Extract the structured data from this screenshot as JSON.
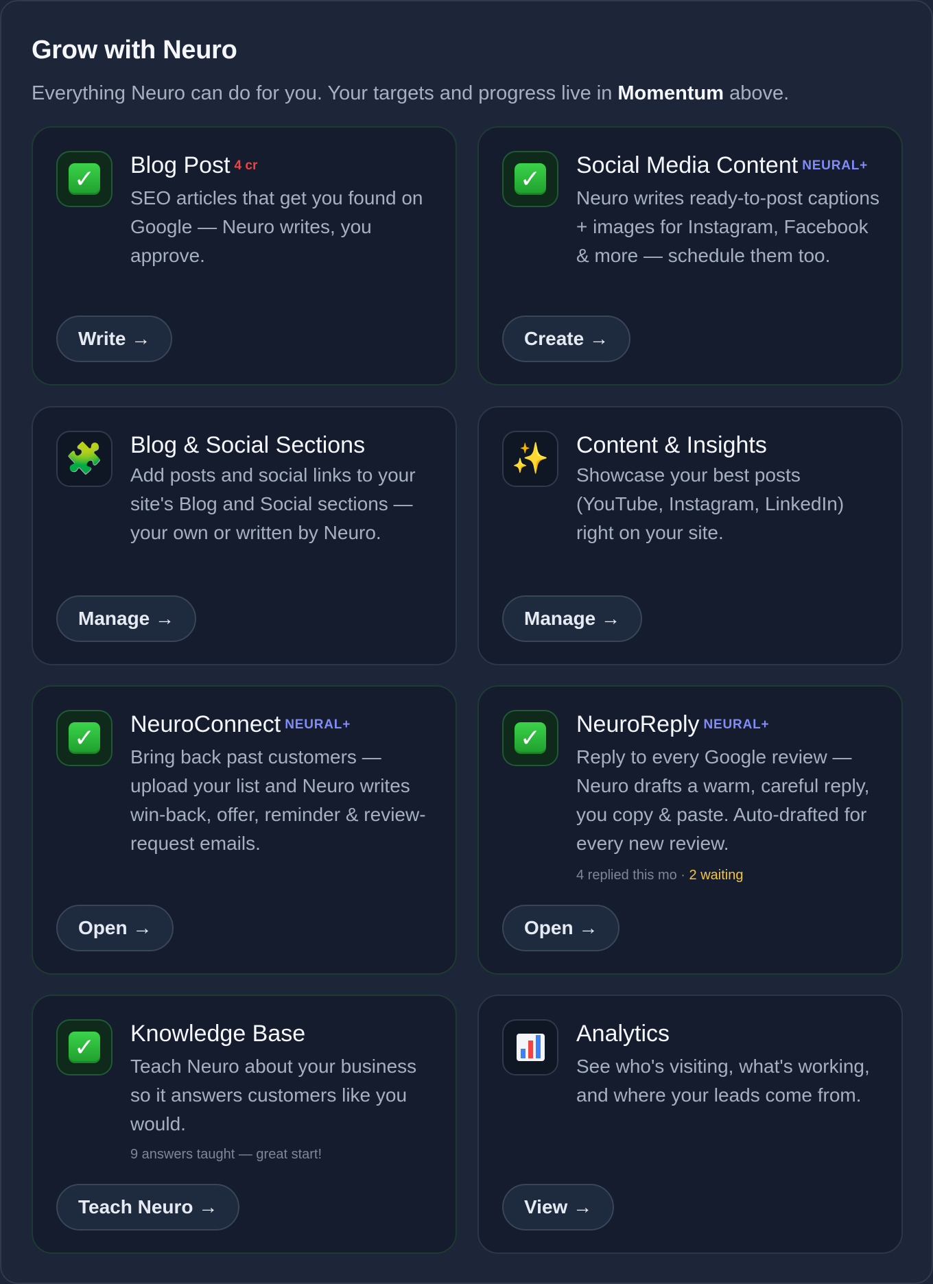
{
  "header": {
    "title": "Grow with Neuro",
    "subtitle_prefix": "Everything Neuro can do for you. Your targets and progress live in ",
    "subtitle_emphasis": "Momentum",
    "subtitle_suffix": " above."
  },
  "cards": [
    {
      "title": "Blog Post",
      "badge": "4 cr",
      "icon": "check-icon",
      "description": "SEO articles that get you found on Google — Neuro writes, you approve.",
      "button": "Write →"
    },
    {
      "title": "Social Media Content",
      "badge": "NEURAL+",
      "icon": "check-icon",
      "description": "Neuro writes ready-to-post captions + images for Instagram, Facebook & more — schedule them too.",
      "button": "Create →"
    },
    {
      "title": "Blog & Social Sections",
      "icon": "puzzle-icon",
      "description": "Add posts and social links to your site's Blog and Social sections — your own or written by Neuro.",
      "button": "Manage →"
    },
    {
      "title": "Content & Insights",
      "icon": "sparkle-icon",
      "description": "Showcase your best posts (YouTube, Instagram, LinkedIn) right on your site.",
      "button": "Manage →"
    },
    {
      "title": "NeuroConnect",
      "badge": "NEURAL+",
      "icon": "check-icon",
      "description": "Bring back past customers — upload your list and Neuro writes win-back, offer, reminder & review-request emails.",
      "button": "Open →"
    },
    {
      "title": "NeuroReply",
      "badge": "NEURAL+",
      "icon": "check-icon",
      "description": "Reply to every Google review — Neuro drafts a warm, careful reply, you copy & paste. Auto-drafted for every new review.",
      "note": "4 replied this mo · ",
      "note_highlight": "2 waiting",
      "button": "Open →"
    },
    {
      "title": "Knowledge Base",
      "icon": "check-icon",
      "description": "Teach Neuro about your business so it answers customers like you would.",
      "note": "9 answers taught — great start!",
      "button": "Teach Neuro →"
    },
    {
      "title": "Analytics",
      "icon": "bar-chart-icon",
      "description": "See who's visiting, what's working, and where your leads come from.",
      "button": "View →"
    }
  ],
  "icons": {
    "check": "✓",
    "puzzle": "🧩",
    "sparkle": "✨"
  },
  "colors": {
    "badge_cr": "#ef4444",
    "badge_neural": "#818cf8",
    "waiting": "#f5c542",
    "check_green": "#2fbf3e"
  }
}
